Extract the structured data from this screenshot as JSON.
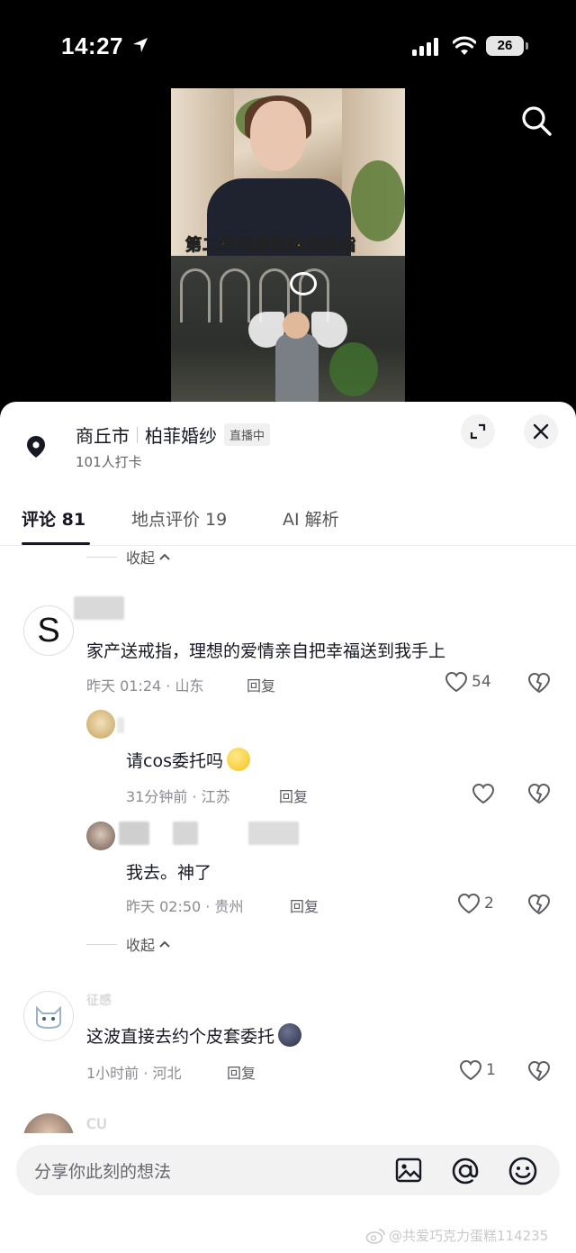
{
  "status_bar": {
    "time": "14:27",
    "battery": "26"
  },
  "video": {
    "caption_prefix": "第二种",
    "caption_highlight": "兄弟姐妹送戒指"
  },
  "place": {
    "city": "商丘市",
    "name": "柏菲婚纱",
    "live_badge": "直播中",
    "checkins": "101人打卡"
  },
  "tabs": [
    {
      "label": "评论 81"
    },
    {
      "label": "地点评价 19"
    },
    {
      "label": "AI 解析"
    }
  ],
  "collapse_label": "收起",
  "reply_label": "回复",
  "comments": [
    {
      "avatar_letter": "S",
      "text": "家产送戒指，理想的爱情亲自把幸福送到我手上",
      "meta": "昨天 01:24 · 山东",
      "likes": "54",
      "replies": [
        {
          "text": "请cos委托吗",
          "meta": "31分钟前 · 江苏",
          "likes": ""
        },
        {
          "text": "我去。神了",
          "meta": "昨天 02:50 · 贵州",
          "likes": "2"
        }
      ]
    },
    {
      "username": "征感",
      "text": "这波直接去约个皮套委托",
      "meta": "1小时前 · 河北",
      "likes": "1"
    },
    {
      "username": "CU"
    }
  ],
  "input": {
    "placeholder": "分享你此刻的想法"
  },
  "watermark": "@共爱巧克力蛋糕114235",
  "colors": {
    "panel_bg": "#ffffff",
    "text": "#161823",
    "meta": "#8a8b91"
  }
}
